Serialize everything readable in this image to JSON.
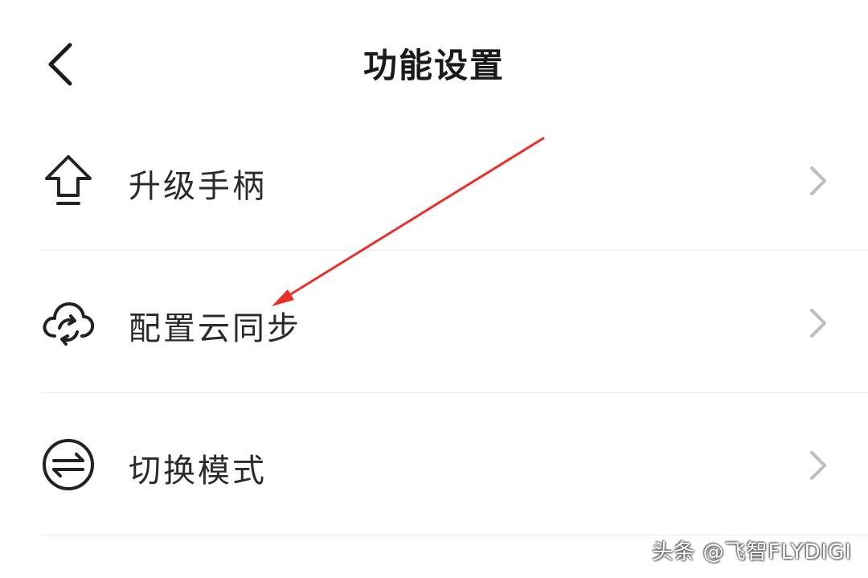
{
  "header": {
    "title": "功能设置",
    "back_icon": "chevron-left-icon"
  },
  "menu": {
    "items": [
      {
        "label": "升级手柄",
        "icon": "upgrade-arrow-icon"
      },
      {
        "label": "配置云同步",
        "icon": "cloud-sync-icon"
      },
      {
        "label": "切换模式",
        "icon": "switch-arrows-icon"
      }
    ],
    "chevron_icon": "chevron-right-icon"
  },
  "annotation": {
    "color": "#e8302a",
    "target": "配置云同步"
  },
  "watermark": {
    "text": "头条 @飞智FLYDIGI"
  },
  "colors": {
    "text": "#2a2a2a",
    "chevron": "#bdbdbd",
    "divider": "#ececec",
    "arrow": "#e8302a"
  }
}
